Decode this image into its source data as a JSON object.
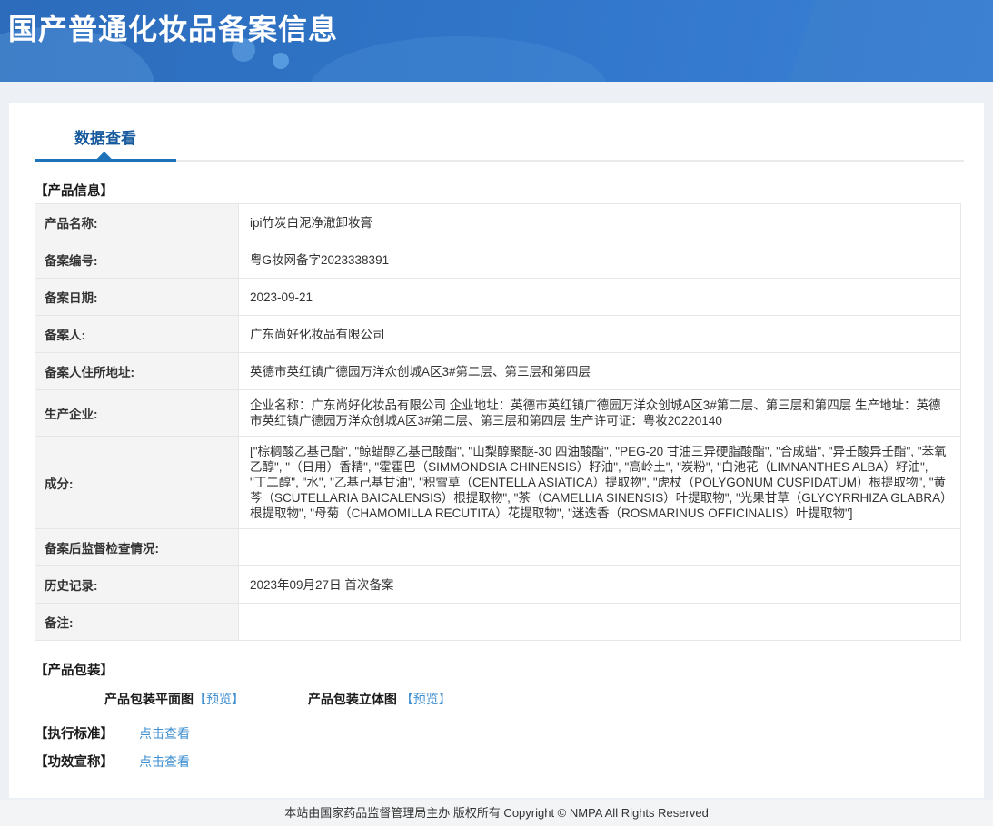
{
  "header": {
    "title": "国产普通化妆品备案信息"
  },
  "tabs": {
    "data_view": "数据查看"
  },
  "sections": {
    "product_info": "【产品信息】",
    "packaging": "【产品包装】",
    "standard": "【执行标准】",
    "efficacy": "【功效宣称】"
  },
  "table": {
    "rows": [
      {
        "label": "产品名称:",
        "value": "ipi竹炭白泥净澈卸妆膏"
      },
      {
        "label": "备案编号:",
        "value": "粤G妆网备字2023338391"
      },
      {
        "label": "备案日期:",
        "value": "2023-09-21"
      },
      {
        "label": "备案人:",
        "value": "广东尚好化妆品有限公司"
      },
      {
        "label": "备案人住所地址:",
        "value": "英德市英红镇广德园万洋众创城A区3#第二层、第三层和第四层"
      },
      {
        "label": "生产企业:",
        "value": "企业名称：广东尚好化妆品有限公司 企业地址：英德市英红镇广德园万洋众创城A区3#第二层、第三层和第四层 生产地址：英德市英红镇广德园万洋众创城A区3#第二层、第三层和第四层 生产许可证：粤妆20220140"
      },
      {
        "label": "成分:",
        "value": "[\"棕榈酸乙基己酯\", \"鲸蜡醇乙基己酸酯\", \"山梨醇聚醚-30 四油酸酯\", \"PEG-20 甘油三异硬脂酸酯\", \"合成蜡\", \"异壬酸异壬酯\", \"苯氧乙醇\", \"（日用）香精\", \"霍霍巴（SIMMONDSIA CHINENSIS）籽油\", \"高岭土\", \"炭粉\", \"白池花（LIMNANTHES ALBA）籽油\", \"丁二醇\", \"水\", \"乙基己基甘油\", \"积雪草（CENTELLA ASIATICA）提取物\", \"虎杖（POLYGONUM CUSPIDATUM）根提取物\", \"黄芩（SCUTELLARIA BAICALENSIS）根提取物\", \"茶（CAMELLIA SINENSIS）叶提取物\", \"光果甘草（GLYCYRRHIZA GLABRA）根提取物\", \"母菊（CHAMOMILLA RECUTITA）花提取物\", \"迷迭香（ROSMARINUS OFFICINALIS）叶提取物\"]"
      },
      {
        "label": "备案后监督检查情况:",
        "value": ""
      },
      {
        "label": "历史记录:",
        "value": "2023年09月27日 首次备案"
      },
      {
        "label": "备注:",
        "value": ""
      }
    ]
  },
  "packaging": {
    "flat_label": "产品包装平面图",
    "flat_preview": "【预览】",
    "stereo_label": "产品包装立体图",
    "stereo_preview": "【预览】"
  },
  "links": {
    "standard_view": "点击查看",
    "efficacy_view": "点击查看"
  },
  "footer": {
    "copyright": "本站由国家药品监督管理局主办 版权所有 Copyright © NMPA All Rights Reserved"
  },
  "colors": {
    "header_blue": "#2f74c7",
    "accent_blue": "#1d72b8",
    "link_blue": "#3e8fd1",
    "label_bg": "#f4f4f4",
    "table_border": "#abc5d8"
  }
}
